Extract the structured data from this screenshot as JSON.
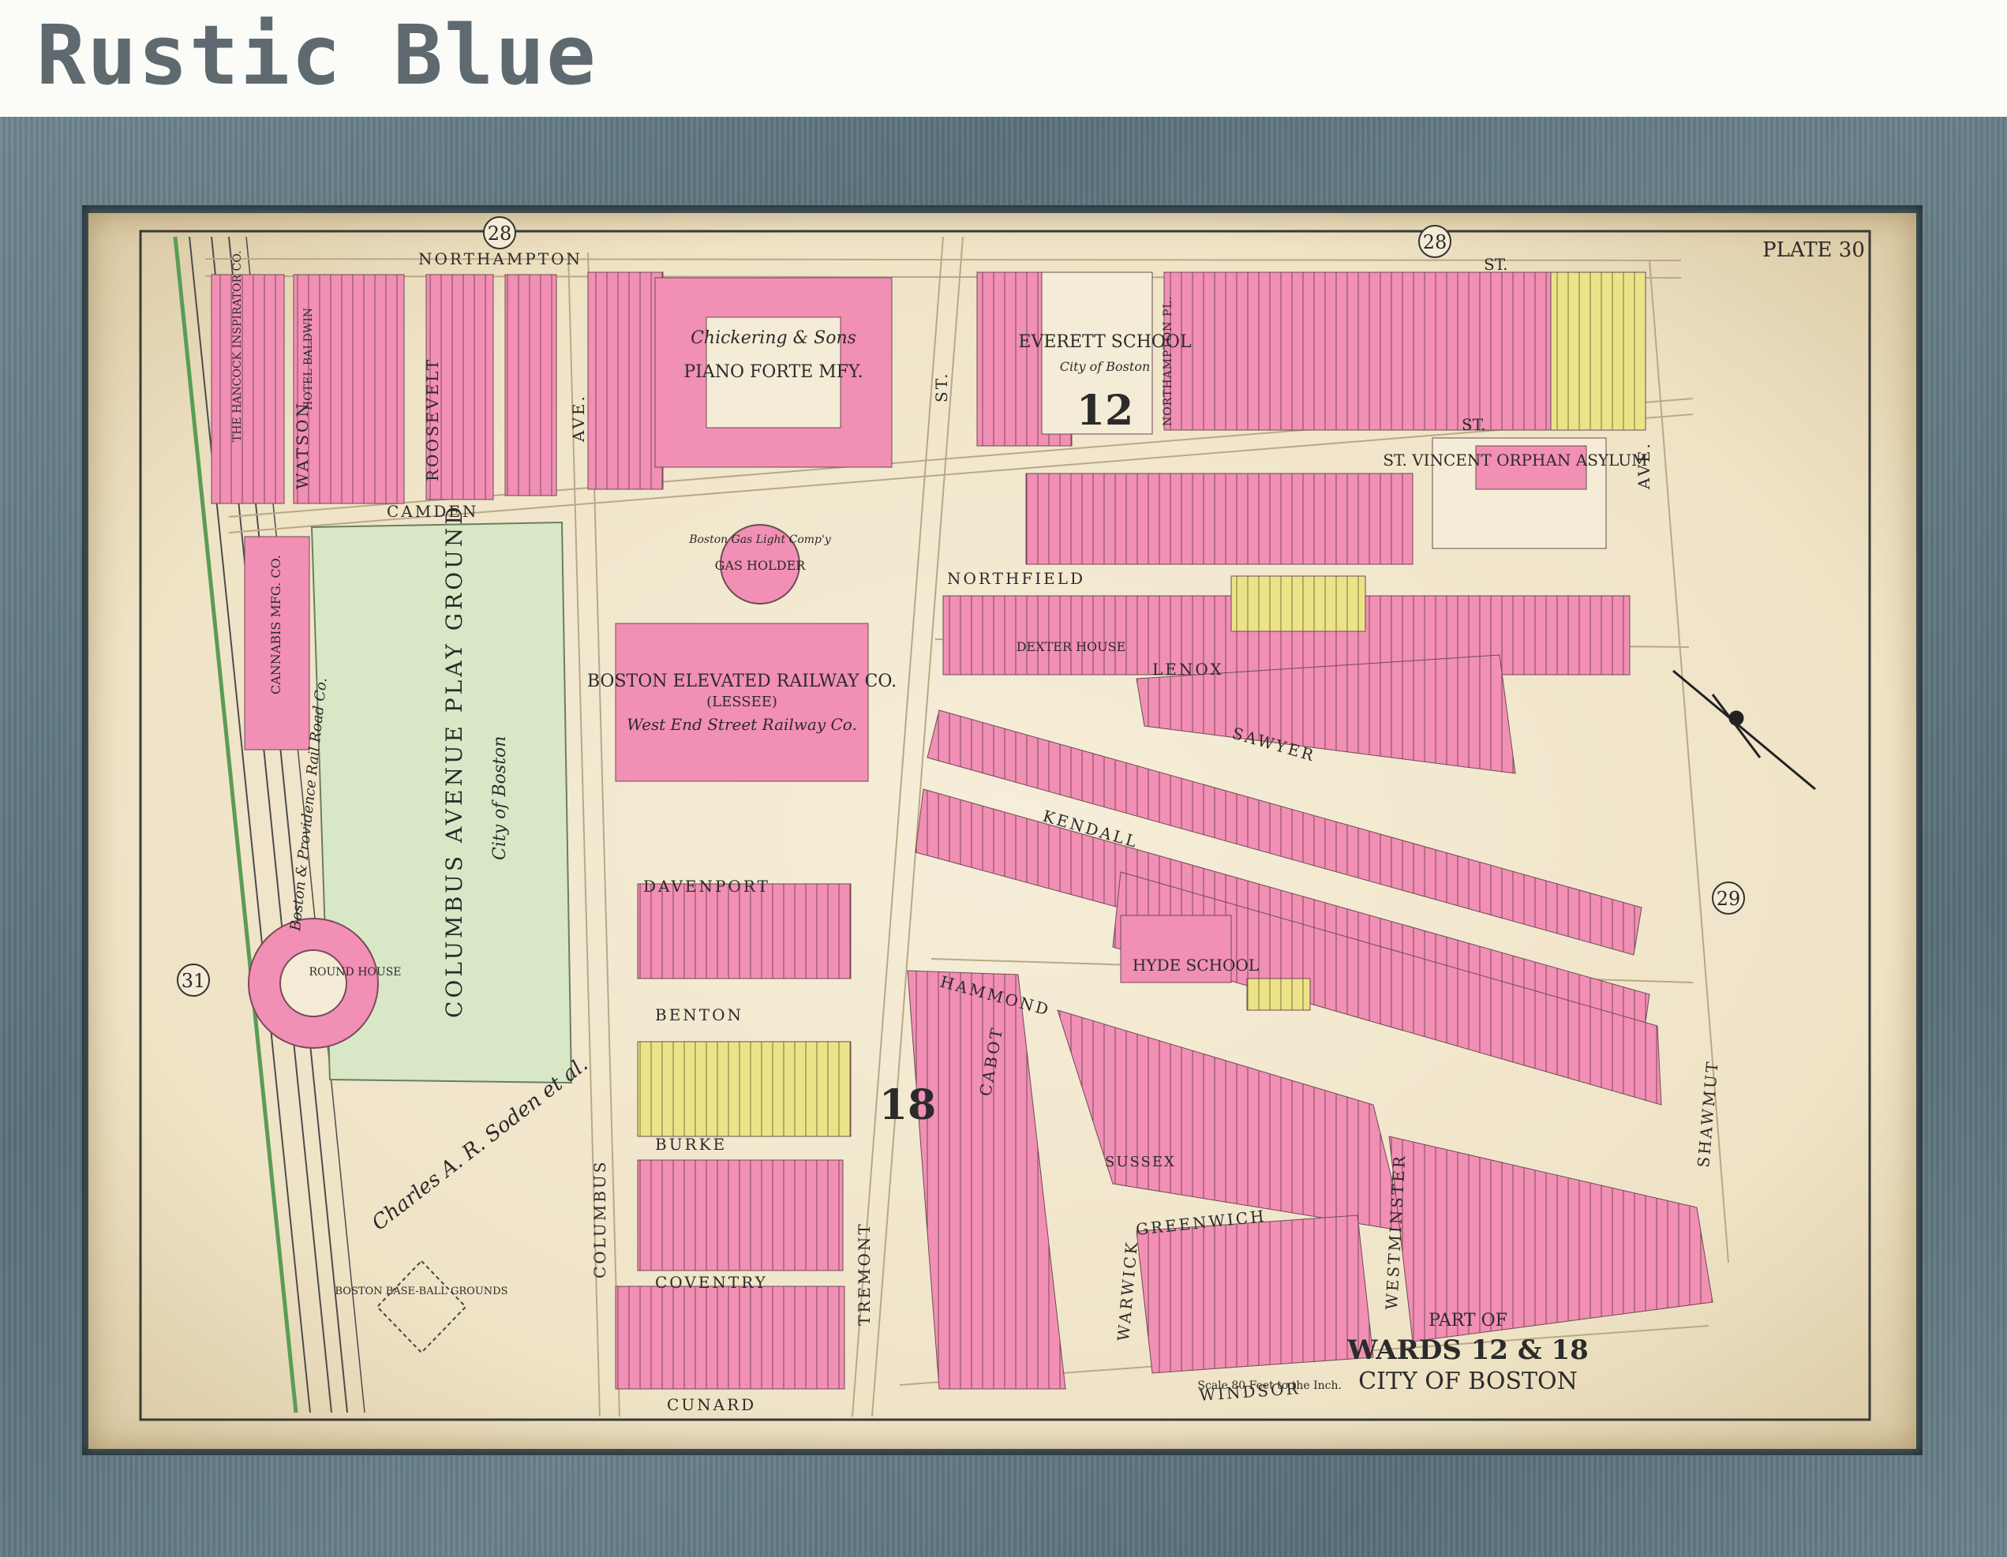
{
  "brand": {
    "title": "Rustic Blue"
  },
  "map": {
    "plate": "PLATE 30",
    "ward_markers": [
      "28",
      "28",
      "29",
      "31",
      "12",
      "18"
    ],
    "title_part": "PART OF",
    "title_wards": "WARDS 12 & 18",
    "title_city": "CITY OF BOSTON",
    "scale": "Scale 80 Feet to the Inch.",
    "streets": {
      "northampton": "NORTHAMPTON",
      "st_top": "ST.",
      "camden": "CAMDEN",
      "watson": "WATSON",
      "roosevelt": "ROOSEVELT",
      "columbus": "COLUMBUS",
      "ave": "AVE.",
      "tremont": "TREMONT",
      "st_tremont": "ST.",
      "davenport": "DAVENPORT",
      "benton": "BENTON",
      "burke": "BURKE",
      "coventry": "COVENTRY",
      "cunard": "CUNARD",
      "northfield": "NORTHFIELD",
      "lenox": "LENOX",
      "sawyer": "SAWYER",
      "kendall": "KENDALL",
      "hammond": "HAMMOND",
      "cabot": "CABOT",
      "warwick": "WARWICK",
      "greenwich": "GREENWICH",
      "sussex": "SUSSEX",
      "westminster": "WESTMINSTER",
      "windsor": "WINDSOR",
      "shawmut": "SHAWMUT",
      "shawmut_ave": "AVE.",
      "northampton_pl": "NORTHAMPTON PL."
    },
    "places": {
      "everett_school": "EVERETT SCHOOL",
      "city_of_boston": "City of Boston",
      "chickering": "Chickering & Sons",
      "piano": "PIANO FORTE MFY.",
      "st_vincent": "ST. VINCENT ORPHAN ASYLUM",
      "gas_holder": "GAS HOLDER",
      "boston_gas": "Boston Gas Light Comp'y",
      "elevated": "BOSTON ELEVATED RAILWAY CO.",
      "lessee": "(LESSEE)",
      "west_end": "West End Street Railway Co.",
      "playground": "COLUMBUS AVENUE PLAY GROUND",
      "playground_city": "City of Boston",
      "round_house": "ROUND HOUSE",
      "baseball": "BOSTON BASE-BALL GROUNDS",
      "railroad": "Boston & Providence Rail Road Co.",
      "dexter_house": "DEXTER HOUSE",
      "hyde_school": "HYDE SCHOOL",
      "hancock": "THE HANCOCK INSPIRATOR CO.",
      "baldwin": "HOTEL BALDWIN",
      "cannabis": "CANNABIS MFG. CO.",
      "soden": "Charles A. R. Soden et al."
    },
    "colors": {
      "pink": "#f28fb4",
      "yellow": "#ece388",
      "green": "#d8e8c6",
      "paper": "#f4ecd6",
      "frame": "#627a83"
    }
  }
}
